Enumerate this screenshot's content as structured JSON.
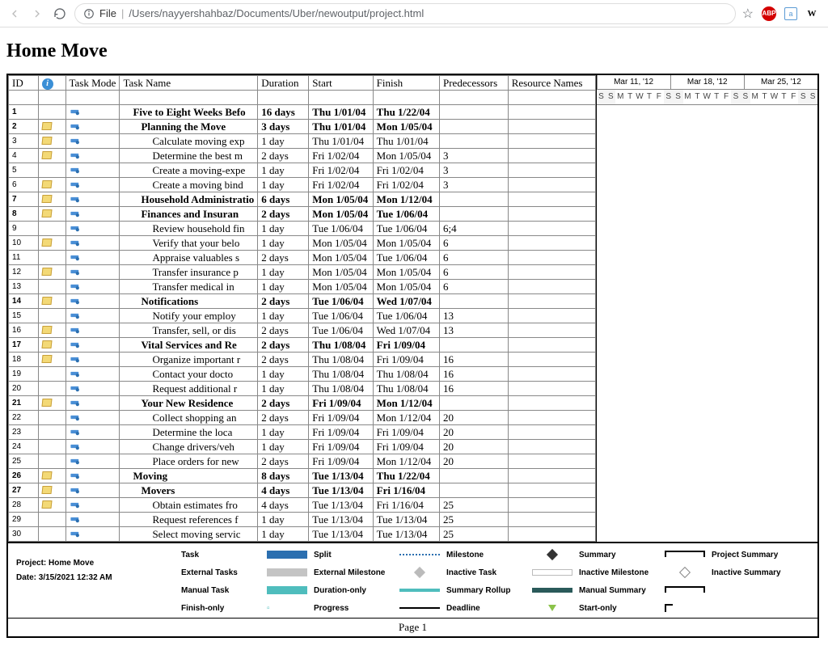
{
  "browser": {
    "url_prefix": "File",
    "url_path": "/Users/nayyershahbaz/Documents/Uber/newoutput/project.html",
    "ext_abp": "ABP",
    "ext_w": "W"
  },
  "page_title": "Home Move",
  "columns": {
    "id": "ID",
    "info": "",
    "mode": "Task Mode",
    "name": "Task Name",
    "dur": "Duration",
    "start": "Start",
    "finish": "Finish",
    "pred": "Predecessors",
    "res": "Resource Names"
  },
  "timeline_weeks": [
    "Mar 11, '12",
    "Mar 18, '12",
    "Mar 25, '12"
  ],
  "timeline_days": [
    "S",
    "S",
    "M",
    "T",
    "W",
    "T",
    "F",
    "S",
    "S",
    "M",
    "T",
    "W",
    "T",
    "F",
    "S",
    "S",
    "M",
    "T",
    "W",
    "T",
    "F",
    "S",
    "S"
  ],
  "rows": [
    {
      "id": "1",
      "note": false,
      "bold": true,
      "indent": 1,
      "name": "Five to Eight Weeks Befo",
      "dur": "16 days",
      "start": "Thu 1/01/04",
      "finish": "Thu 1/22/04",
      "pred": ""
    },
    {
      "id": "2",
      "note": true,
      "bold": true,
      "indent": 2,
      "name": "Planning the Move",
      "dur": "3 days",
      "start": "Thu 1/01/04",
      "finish": "Mon 1/05/04",
      "pred": ""
    },
    {
      "id": "3",
      "note": true,
      "bold": false,
      "indent": 3,
      "name": "Calculate moving exp",
      "dur": "1 day",
      "start": "Thu 1/01/04",
      "finish": "Thu 1/01/04",
      "pred": ""
    },
    {
      "id": "4",
      "note": true,
      "bold": false,
      "indent": 3,
      "name": "Determine the best m",
      "dur": "2 days",
      "start": "Fri 1/02/04",
      "finish": "Mon 1/05/04",
      "pred": "3"
    },
    {
      "id": "5",
      "note": false,
      "bold": false,
      "indent": 3,
      "name": "Create a moving-expe",
      "dur": "1 day",
      "start": "Fri 1/02/04",
      "finish": "Fri 1/02/04",
      "pred": "3"
    },
    {
      "id": "6",
      "note": true,
      "bold": false,
      "indent": 3,
      "name": "Create a moving bind",
      "dur": "1 day",
      "start": "Fri 1/02/04",
      "finish": "Fri 1/02/04",
      "pred": "3"
    },
    {
      "id": "7",
      "note": true,
      "bold": true,
      "indent": 2,
      "name": "Household Administratio",
      "dur": "6 days",
      "start": "Mon 1/05/04",
      "finish": "Mon 1/12/04",
      "pred": ""
    },
    {
      "id": "8",
      "note": true,
      "bold": true,
      "indent": 2,
      "name": "Finances and Insuran",
      "dur": "2 days",
      "start": "Mon 1/05/04",
      "finish": "Tue 1/06/04",
      "pred": ""
    },
    {
      "id": "9",
      "note": false,
      "bold": false,
      "indent": 3,
      "name": "Review household fin",
      "dur": "1 day",
      "start": "Tue 1/06/04",
      "finish": "Tue 1/06/04",
      "pred": "6;4"
    },
    {
      "id": "10",
      "note": true,
      "bold": false,
      "indent": 3,
      "name": "Verify that your belo",
      "dur": "1 day",
      "start": "Mon 1/05/04",
      "finish": "Mon 1/05/04",
      "pred": "6"
    },
    {
      "id": "11",
      "note": false,
      "bold": false,
      "indent": 3,
      "name": "Appraise valuables s",
      "dur": "2 days",
      "start": "Mon 1/05/04",
      "finish": "Tue 1/06/04",
      "pred": "6"
    },
    {
      "id": "12",
      "note": true,
      "bold": false,
      "indent": 3,
      "name": "Transfer insurance p",
      "dur": "1 day",
      "start": "Mon 1/05/04",
      "finish": "Mon 1/05/04",
      "pred": "6"
    },
    {
      "id": "13",
      "note": false,
      "bold": false,
      "indent": 3,
      "name": "Transfer medical in",
      "dur": "1 day",
      "start": "Mon 1/05/04",
      "finish": "Mon 1/05/04",
      "pred": "6"
    },
    {
      "id": "14",
      "note": true,
      "bold": true,
      "indent": 2,
      "name": "Notifications",
      "dur": "2 days",
      "start": "Tue 1/06/04",
      "finish": "Wed 1/07/04",
      "pred": ""
    },
    {
      "id": "15",
      "note": false,
      "bold": false,
      "indent": 3,
      "name": "Notify your employ",
      "dur": "1 day",
      "start": "Tue 1/06/04",
      "finish": "Tue 1/06/04",
      "pred": "13"
    },
    {
      "id": "16",
      "note": true,
      "bold": false,
      "indent": 3,
      "name": "Transfer, sell, or dis",
      "dur": "2 days",
      "start": "Tue 1/06/04",
      "finish": "Wed 1/07/04",
      "pred": "13"
    },
    {
      "id": "17",
      "note": true,
      "bold": true,
      "indent": 2,
      "name": "Vital Services and Re",
      "dur": "2 days",
      "start": "Thu 1/08/04",
      "finish": "Fri 1/09/04",
      "pred": ""
    },
    {
      "id": "18",
      "note": true,
      "bold": false,
      "indent": 3,
      "name": "Organize important r",
      "dur": "2 days",
      "start": "Thu 1/08/04",
      "finish": "Fri 1/09/04",
      "pred": "16"
    },
    {
      "id": "19",
      "note": false,
      "bold": false,
      "indent": 3,
      "name": "Contact your docto",
      "dur": "1 day",
      "start": "Thu 1/08/04",
      "finish": "Thu 1/08/04",
      "pred": "16"
    },
    {
      "id": "20",
      "note": false,
      "bold": false,
      "indent": 3,
      "name": "Request additional r",
      "dur": "1 day",
      "start": "Thu 1/08/04",
      "finish": "Thu 1/08/04",
      "pred": "16"
    },
    {
      "id": "21",
      "note": true,
      "bold": true,
      "indent": 2,
      "name": "Your New Residence",
      "dur": "2 days",
      "start": "Fri 1/09/04",
      "finish": "Mon 1/12/04",
      "pred": ""
    },
    {
      "id": "22",
      "note": false,
      "bold": false,
      "indent": 3,
      "name": "Collect shopping an",
      "dur": "2 days",
      "start": "Fri 1/09/04",
      "finish": "Mon 1/12/04",
      "pred": "20"
    },
    {
      "id": "23",
      "note": false,
      "bold": false,
      "indent": 3,
      "name": "Determine the loca",
      "dur": "1 day",
      "start": "Fri 1/09/04",
      "finish": "Fri 1/09/04",
      "pred": "20"
    },
    {
      "id": "24",
      "note": false,
      "bold": false,
      "indent": 3,
      "name": "Change drivers/veh",
      "dur": "1 day",
      "start": "Fri 1/09/04",
      "finish": "Fri 1/09/04",
      "pred": "20"
    },
    {
      "id": "25",
      "note": false,
      "bold": false,
      "indent": 3,
      "name": "Place orders for new",
      "dur": "2 days",
      "start": "Fri 1/09/04",
      "finish": "Mon 1/12/04",
      "pred": "20"
    },
    {
      "id": "26",
      "note": true,
      "bold": true,
      "indent": 1,
      "name": "Moving",
      "dur": "8 days",
      "start": "Tue 1/13/04",
      "finish": "Thu 1/22/04",
      "pred": ""
    },
    {
      "id": "27",
      "note": true,
      "bold": true,
      "indent": 2,
      "name": "Movers",
      "dur": "4 days",
      "start": "Tue 1/13/04",
      "finish": "Fri 1/16/04",
      "pred": ""
    },
    {
      "id": "28",
      "note": true,
      "bold": false,
      "indent": 3,
      "name": "Obtain estimates fro",
      "dur": "4 days",
      "start": "Tue 1/13/04",
      "finish": "Fri 1/16/04",
      "pred": "25"
    },
    {
      "id": "29",
      "note": false,
      "bold": false,
      "indent": 3,
      "name": "Request references f",
      "dur": "1 day",
      "start": "Tue 1/13/04",
      "finish": "Tue 1/13/04",
      "pred": "25"
    },
    {
      "id": "30",
      "note": false,
      "bold": false,
      "indent": 3,
      "name": "Select moving servic",
      "dur": "1 day",
      "start": "Tue 1/13/04",
      "finish": "Tue 1/13/04",
      "pred": "25"
    }
  ],
  "legend": {
    "project_label": "Project: Home Move",
    "date_label": "Date: 3/15/2021 12:32 AM",
    "items_col1": [
      "Task",
      "External Tasks",
      "Manual Task",
      "Finish-only"
    ],
    "items_col2": [
      "Split",
      "External Milestone",
      "Duration-only",
      "Progress"
    ],
    "items_col3": [
      "Milestone",
      "Inactive Task",
      "Summary Rollup",
      "Deadline"
    ],
    "items_col4": [
      "Summary",
      "Inactive Milestone",
      "Manual Summary",
      "Start-only"
    ],
    "items_col5": [
      "Project Summary",
      "Inactive Summary",
      ""
    ]
  },
  "footer": "Page 1"
}
